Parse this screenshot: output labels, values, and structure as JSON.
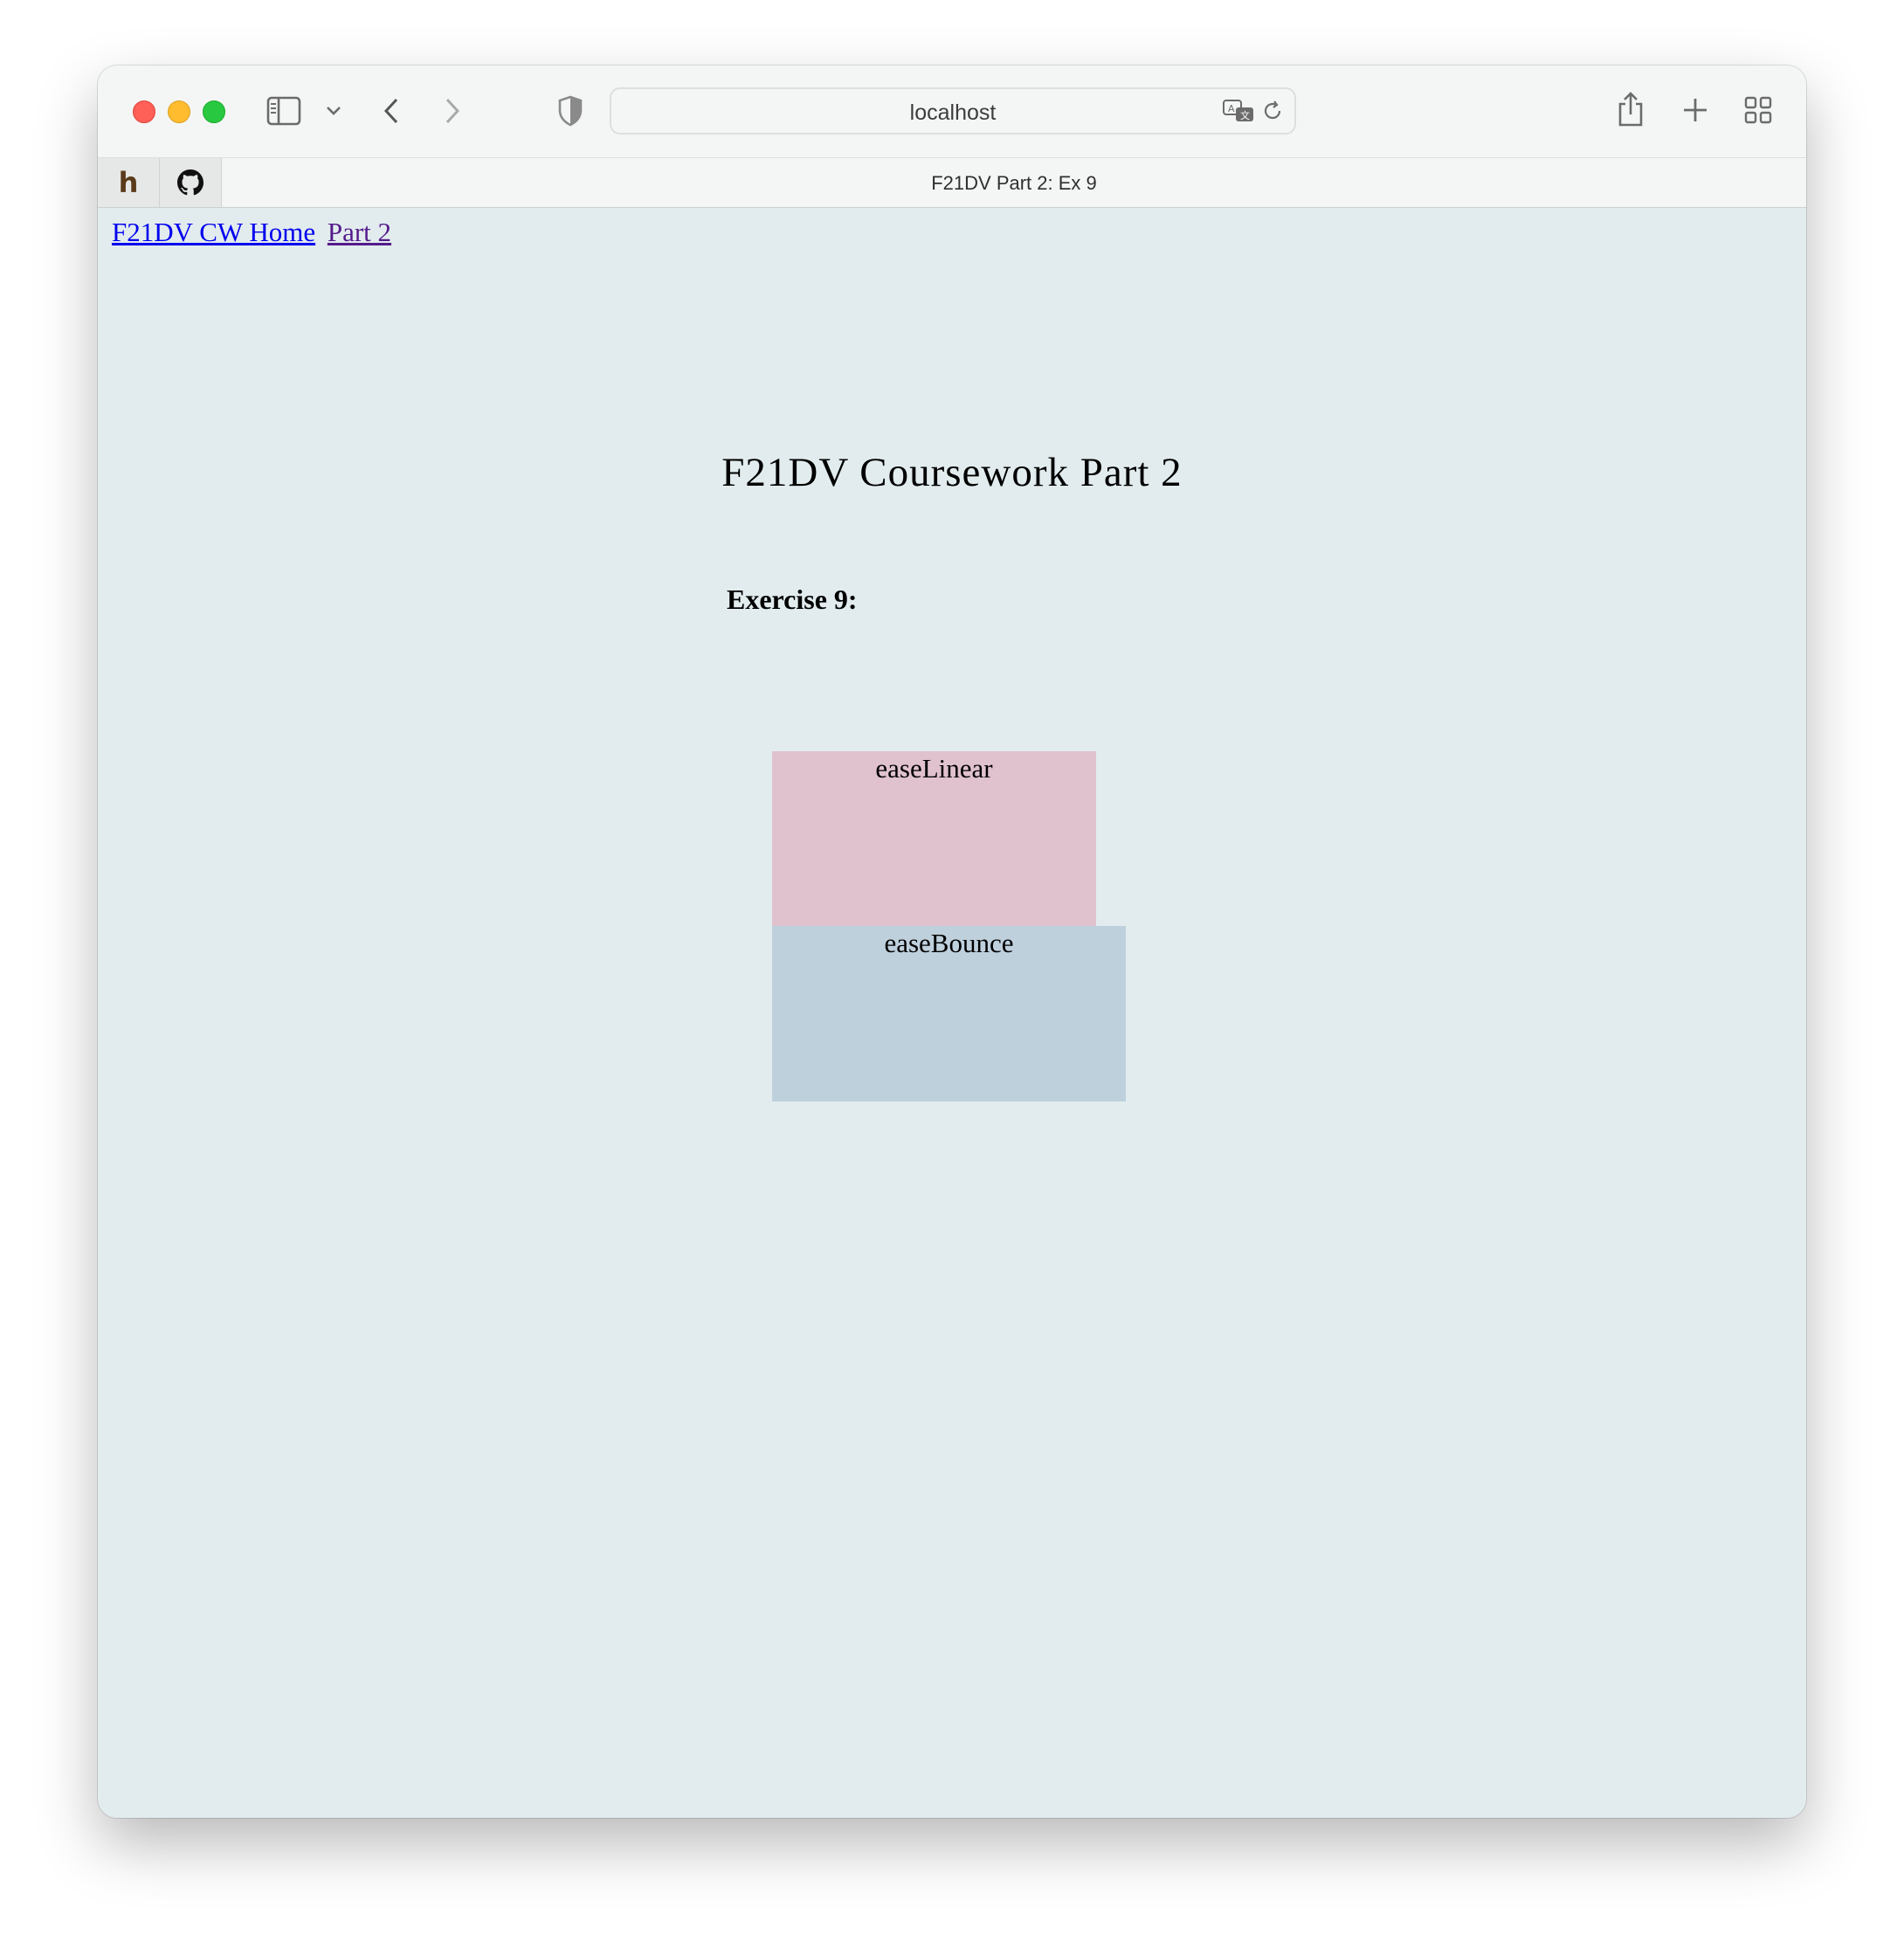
{
  "browser": {
    "url": "localhost",
    "tab_title": "F21DV Part 2: Ex 9",
    "icons": {
      "sidebar": "sidebar-icon",
      "back": "chevron-left-icon",
      "forward": "chevron-right-icon",
      "privacy": "shield-icon",
      "translate": "translate-icon",
      "reload": "reload-icon",
      "share": "share-icon",
      "new_tab": "plus-icon",
      "tab_overview": "grid-icon"
    }
  },
  "favorites": [
    {
      "name": "h",
      "icon": "h-favicon"
    },
    {
      "name": "github",
      "icon": "github-icon"
    }
  ],
  "nav": {
    "home_link": "F21DV CW Home",
    "part2_link": "Part 2"
  },
  "page": {
    "title": "F21DV Coursework Part 2",
    "exercise_heading": "Exercise 9:"
  },
  "boxes": [
    {
      "label": "easeLinear",
      "color": "#e0c2ce"
    },
    {
      "label": "easeBounce",
      "color": "#bfd0dd"
    }
  ],
  "colors": {
    "page_bg": "#e2ecee",
    "link": "#0000ee",
    "visited_link": "#551a8b"
  }
}
